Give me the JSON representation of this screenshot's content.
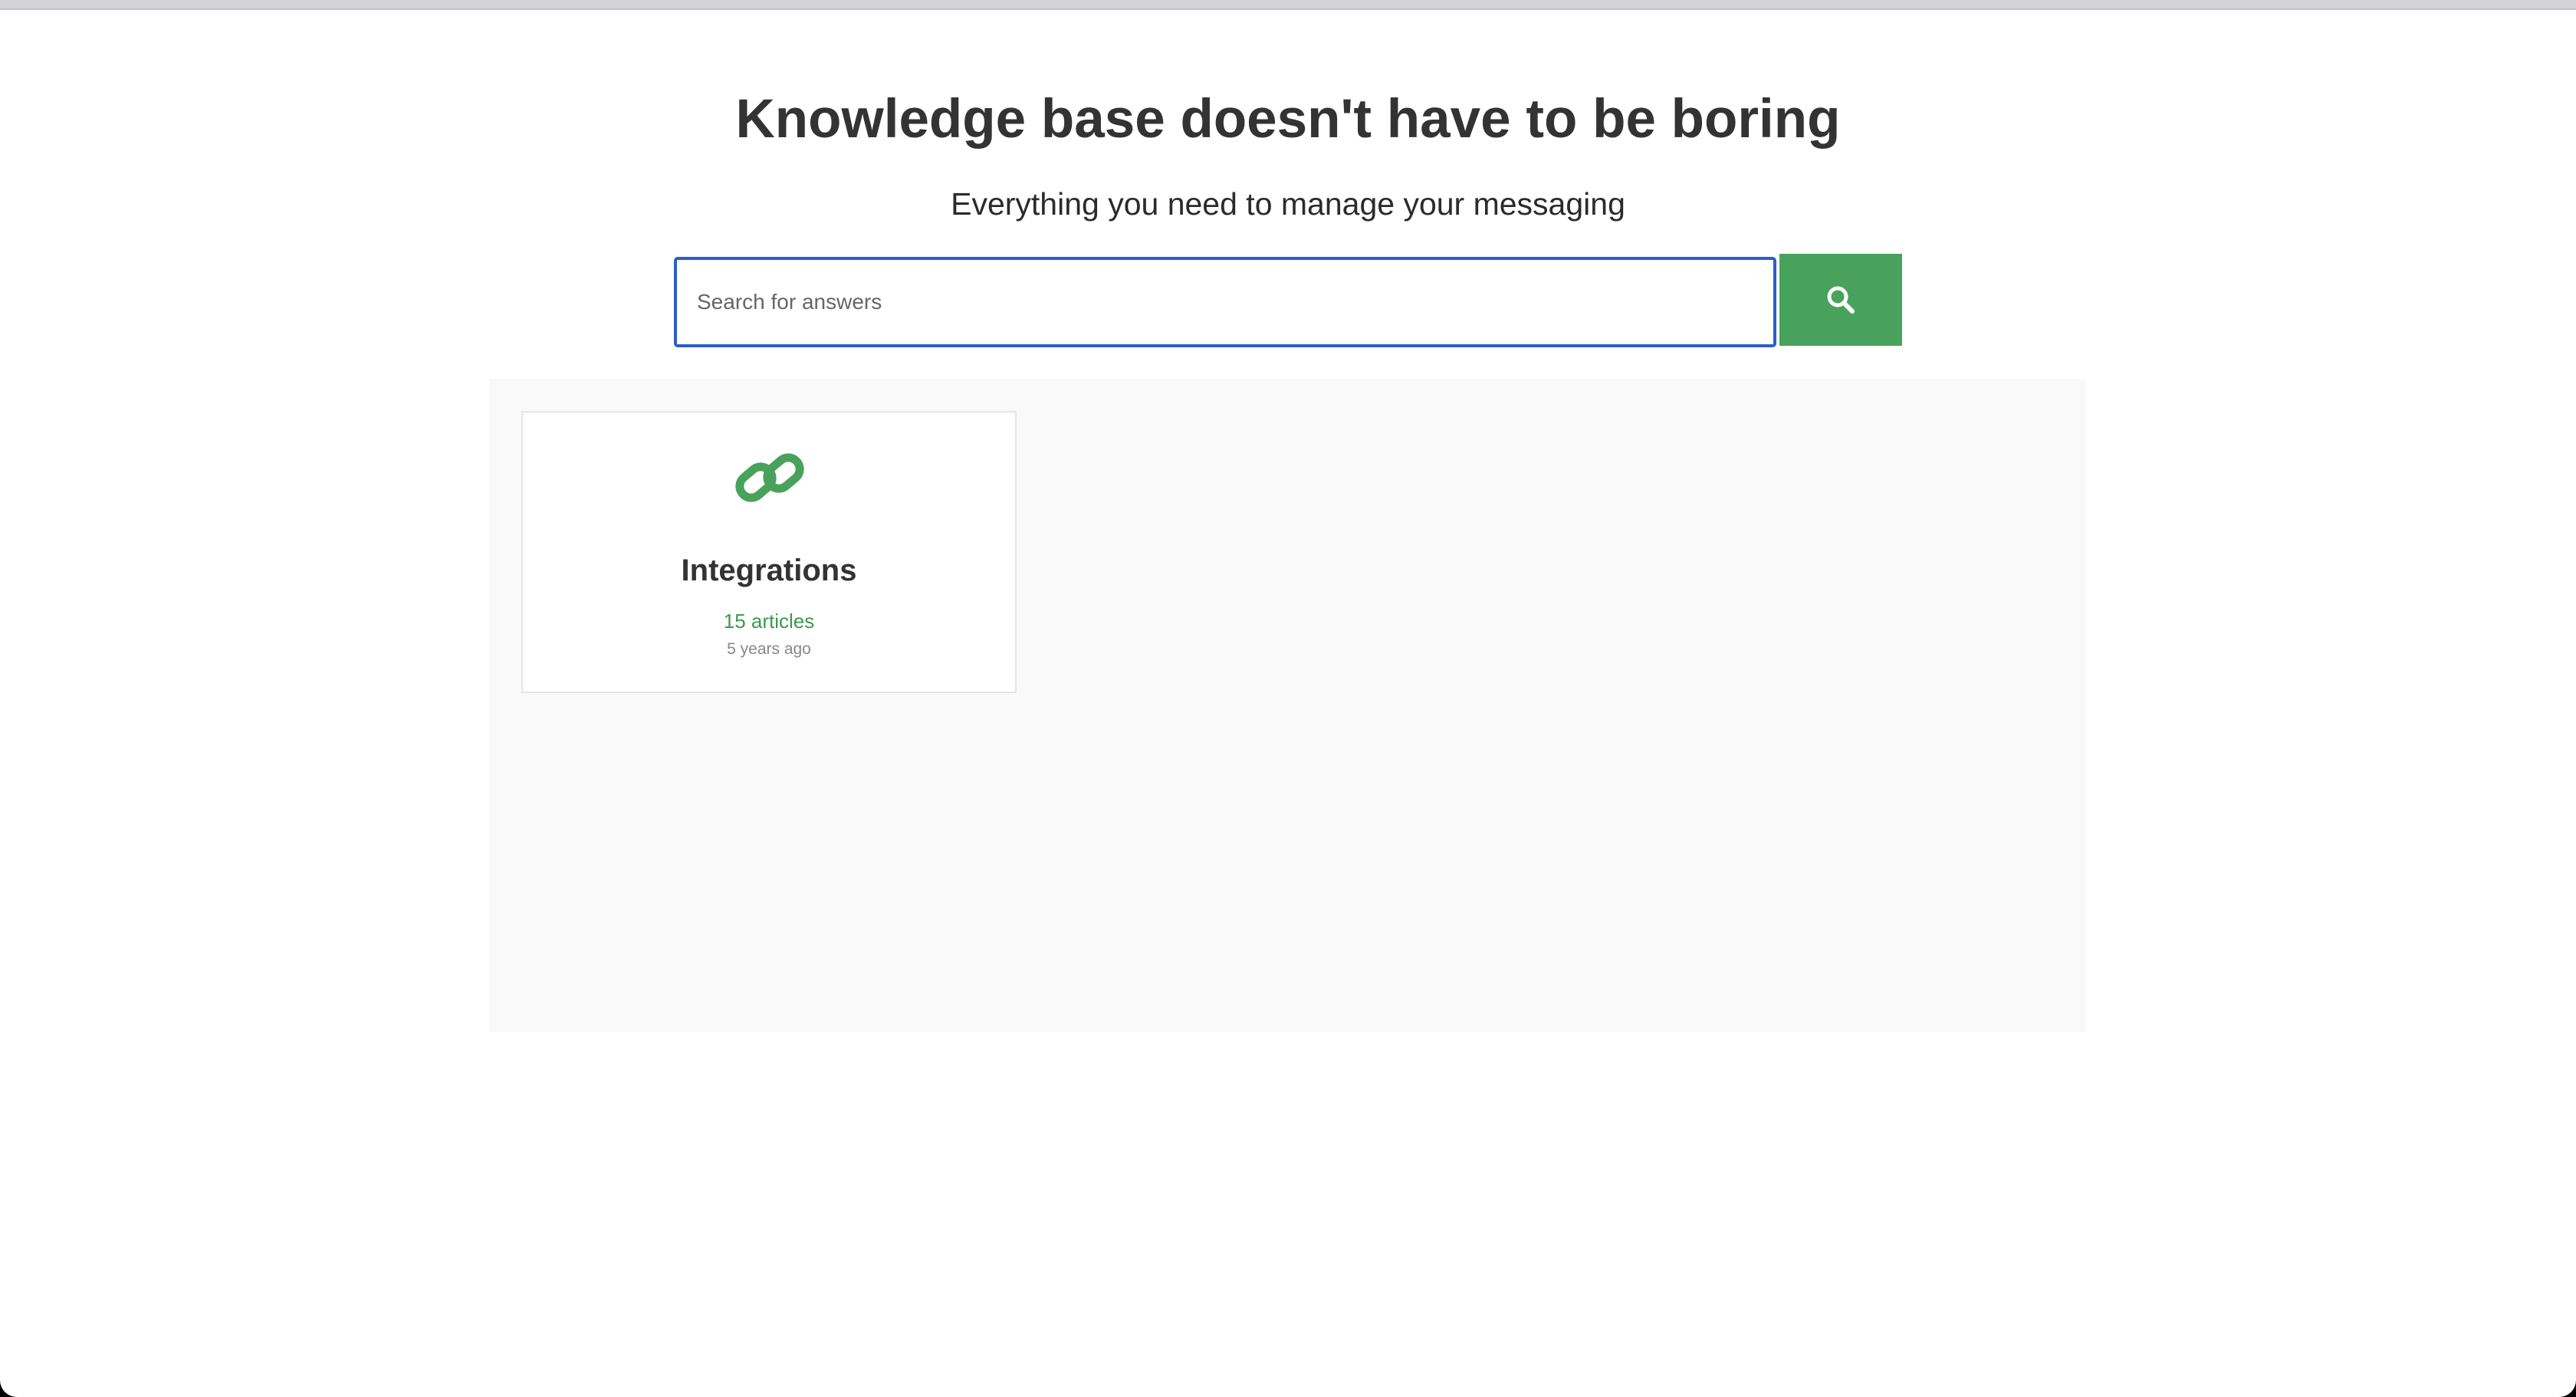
{
  "hero": {
    "title": "Knowledge base doesn't have to be boring",
    "subtitle": "Everything you need to manage your messaging"
  },
  "search": {
    "value": "",
    "placeholder": "Search for answers",
    "button_icon": "search-icon"
  },
  "categories": [
    {
      "icon": "link-icon",
      "title": "Integrations",
      "article_count": "15 articles",
      "updated": "5 years ago"
    }
  ],
  "colors": {
    "accent": "#49a25c",
    "link_green": "#3c9a4d",
    "focus_border": "#2a5fc8",
    "heading": "#333333",
    "content_background": "#f9f9f9"
  }
}
